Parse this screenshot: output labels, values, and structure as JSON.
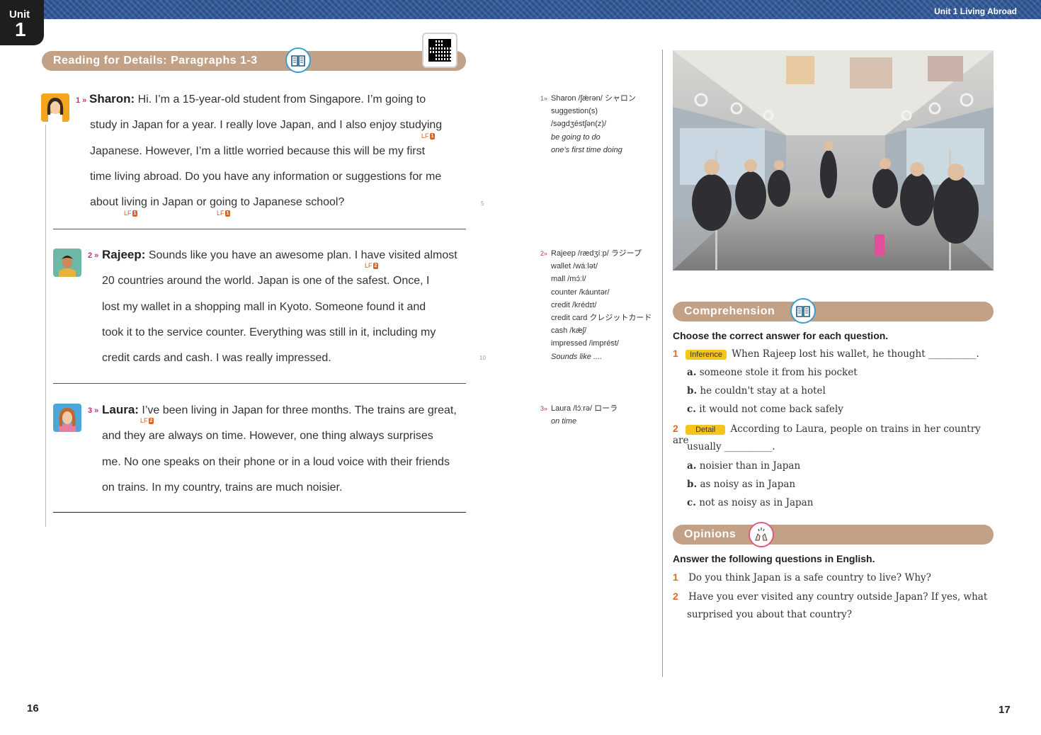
{
  "header": {
    "unit_label": "Unit",
    "unit_number": "1",
    "running_title": "Unit 1  Living Abroad"
  },
  "reading": {
    "title": "Reading for Details: Paragraphs 1-3",
    "paragraphs": [
      {
        "num": "1 »",
        "speaker": "Sharon:",
        "lines": [
          " Hi. I’m a 15-year-old student from Singapore. I’m going to",
          "study in Japan for a year. I really love Japan, and I also enjoy studying",
          "Japanese. However, I’m a little worried because this will be my first",
          "time living abroad. Do you have any information or suggestions for me",
          "about living in Japan or going to Japanese school?"
        ]
      },
      {
        "num": "2 »",
        "speaker": "Rajeep:",
        "lines": [
          " Sounds like you have an awesome plan. I have visited almost",
          "20 countries around the world. Japan is one of the safest. Once, I",
          "lost my wallet in a shopping mall in Kyoto. Someone found it and",
          "took it to the service counter. Everything was still in it, including my",
          "credit cards and cash. I was really impressed."
        ]
      },
      {
        "num": "3 »",
        "speaker": "Laura:",
        "lines": [
          " I’ve been living in Japan for three months. The trains are great,",
          "and they are always on time. However, one thing always surprises",
          "me. No one speaks on their phone or in a loud voice with their friends",
          "on trains. In my country, trains are much noisier."
        ]
      }
    ],
    "lf_labels": {
      "lf1": "LF",
      "lf1_num": "1",
      "lf2": "LF",
      "lf2_num": "2"
    },
    "line_numbers": {
      "five": "5",
      "ten": "10"
    }
  },
  "glossary": {
    "g1": {
      "num": "1»",
      "lines": [
        "Sharon /ʃǽrən/  シャロン",
        "suggestion(s)",
        "/səgdʒéstʃən(z)/",
        "be going to do",
        "one’s first time doing"
      ]
    },
    "g2": {
      "num": "2»",
      "lines": [
        "Rajeep /rædʒíːp/  ラジープ",
        "wallet /wáːlət/",
        "mall /mɔ́ːl/",
        "counter /káuntər/",
        "credit /krédɪt/",
        "credit card  クレジットカード",
        "cash /kǽʃ/",
        "impressed /imprést/",
        "Sounds like ...."
      ]
    },
    "g3": {
      "num": "3»",
      "lines": [
        "Laura /lɔ́ːrə/  ローラ",
        "on time"
      ]
    }
  },
  "comprehension": {
    "title": "Comprehension",
    "instruction": "Choose the correct answer for each question.",
    "questions": [
      {
        "num": "1",
        "tag": "Inference",
        "text": "When Rajeep lost his wallet, he thought __________.",
        "options": [
          {
            "l": "a.",
            "t": "someone stole it from his pocket"
          },
          {
            "l": "b.",
            "t": "he couldn't stay at a hotel"
          },
          {
            "l": "c.",
            "t": "it would not come back safely"
          }
        ]
      },
      {
        "num": "2",
        "tag": "Detail",
        "text": "According to Laura, people on trains in her country are",
        "text2": "usually __________.",
        "options": [
          {
            "l": "a.",
            "t": "noisier than in Japan"
          },
          {
            "l": "b.",
            "t": "as noisy as in Japan"
          },
          {
            "l": "c.",
            "t": "not as noisy as in Japan"
          }
        ]
      }
    ]
  },
  "opinions": {
    "title": "Opinions",
    "instruction": "Answer the following questions in English.",
    "questions": [
      {
        "num": "1",
        "text": "Do you think Japan is a safe country to live? Why?"
      },
      {
        "num": "2",
        "text": "Have you ever visited any country outside Japan? If yes, what",
        "text2": "surprised you about that country?"
      }
    ]
  },
  "page_numbers": {
    "left": "16",
    "right": "17"
  },
  "colors": {
    "bar": "#c2a186",
    "band": "#2c4f86",
    "accent_orange": "#e06a1f",
    "tag_yellow": "#f6c51c",
    "para_pink": "#c2307a"
  }
}
